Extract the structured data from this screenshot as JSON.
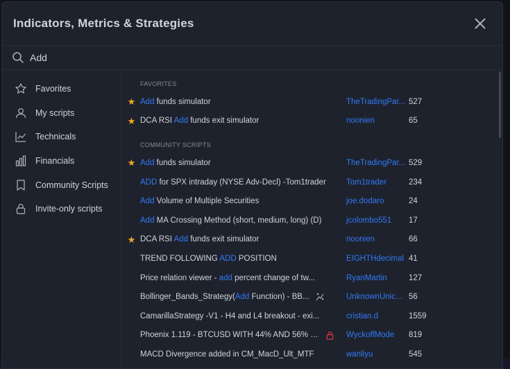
{
  "dialog": {
    "title": "Indicators, Metrics & Strategies"
  },
  "search": {
    "value": "Add",
    "placeholder": "Search"
  },
  "sidebar": {
    "items": [
      {
        "label": "Favorites",
        "icon": "star-outline-icon"
      },
      {
        "label": "My scripts",
        "icon": "user-icon"
      },
      {
        "label": "Technicals",
        "icon": "chart-line-icon"
      },
      {
        "label": "Financials",
        "icon": "bar-chart-icon"
      },
      {
        "label": "Community Scripts",
        "icon": "bookmark-icon"
      },
      {
        "label": "Invite-only scripts",
        "icon": "lock-icon"
      }
    ]
  },
  "sections": {
    "favorites_label": "FAVORITES",
    "community_label": "COMMUNITY SCRIPTS"
  },
  "favorites": [
    {
      "star": true,
      "pre": "",
      "hl": "Add",
      "post": " funds simulator",
      "author": "TheTradingPar...",
      "count": "527"
    },
    {
      "star": true,
      "pre": "DCA RSI ",
      "hl": "Add",
      "post": " funds exit simulator",
      "author": "noonien",
      "count": "65"
    }
  ],
  "community": [
    {
      "star": true,
      "pre": "",
      "hl": "Add",
      "post": " funds simulator",
      "author": "TheTradingPar...",
      "count": "529"
    },
    {
      "star": false,
      "pre": "",
      "hl": "ADD",
      "post": " for SPX intraday (NYSE Adv-Decl) -Tom1trader",
      "author": "Tom1trader",
      "count": "234"
    },
    {
      "star": false,
      "pre": "",
      "hl": "Add",
      "post": " Volume of Multiple Securities",
      "author": "joe.dodaro",
      "count": "24"
    },
    {
      "star": false,
      "pre": "",
      "hl": "Add",
      "post": " MA Crossing Method (short, medium, long) (D)",
      "author": "jcolombo551",
      "count": "17"
    },
    {
      "star": true,
      "pre": "DCA RSI ",
      "hl": "Add",
      "post": " funds exit simulator",
      "author": "noonien",
      "count": "66"
    },
    {
      "star": false,
      "pre": "TREND FOLLOWING ",
      "hl": "ADD",
      "post": " POSITION",
      "author": "EIGHTHdecimal",
      "count": "41"
    },
    {
      "star": false,
      "pre": "Price relation viewer - ",
      "hl": "add",
      "post": " percent change of tw...",
      "author": "RyanMartin",
      "count": "127"
    },
    {
      "star": false,
      "pre": "Bollinger_Bands_Strategy(",
      "hl": "Add",
      "post": " Function) - BB...",
      "badge": "strategy-icon",
      "author": "UnknownUnic...",
      "count": "56"
    },
    {
      "star": false,
      "pre": "CamarillaStrategy -V1 - H4 and L4 breakout - exi...",
      "hl": "",
      "post": "",
      "author": "cristian.d",
      "count": "1559"
    },
    {
      "star": false,
      "pre": "Phoenix 1.119 - BTCUSD WITH 44% AND 56% L...",
      "hl": "",
      "post": "",
      "badge": "lock-icon",
      "author": "WyckoffMode",
      "count": "819"
    },
    {
      "star": false,
      "pre": "MACD Divergence added in CM_MacD_Ult_MTF",
      "hl": "",
      "post": "",
      "author": "wanliyu",
      "count": "545"
    }
  ],
  "colors": {
    "accent": "#3179f5",
    "star": "#f5a623",
    "lock": "#f23645"
  }
}
